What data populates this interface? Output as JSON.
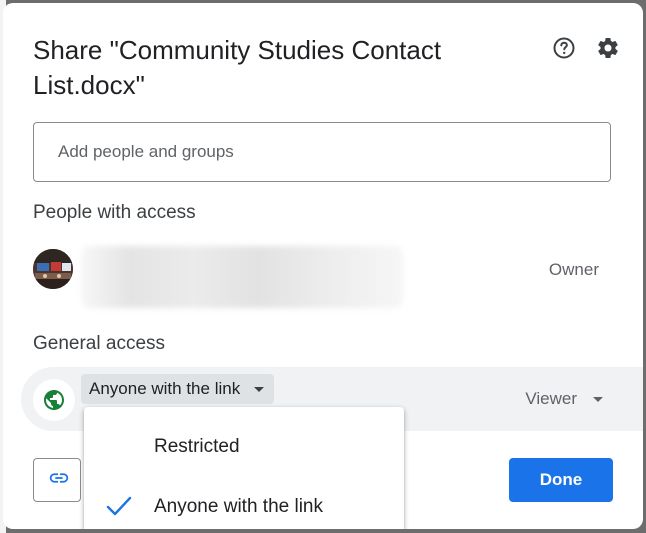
{
  "dialog": {
    "title": "Share \"Community Studies Contact List.docx\"",
    "help_icon": "help-circle-icon",
    "settings_icon": "gear-icon"
  },
  "add_people": {
    "placeholder": "Add people and groups"
  },
  "people_with_access": {
    "heading": "People with access",
    "people": [
      {
        "role": "Owner"
      }
    ]
  },
  "general_access": {
    "heading": "General access",
    "icon": "globe-icon",
    "access_level": "Anyone with the link",
    "role": "Viewer",
    "options": [
      {
        "label": "Restricted",
        "selected": false
      },
      {
        "label": "Anyone with the link",
        "selected": true
      }
    ]
  },
  "footer": {
    "copy_link_icon": "link-icon",
    "done_label": "Done"
  },
  "colors": {
    "accent": "#1a73e8",
    "globe": "#188038",
    "overlay": "#6d6d6d"
  }
}
